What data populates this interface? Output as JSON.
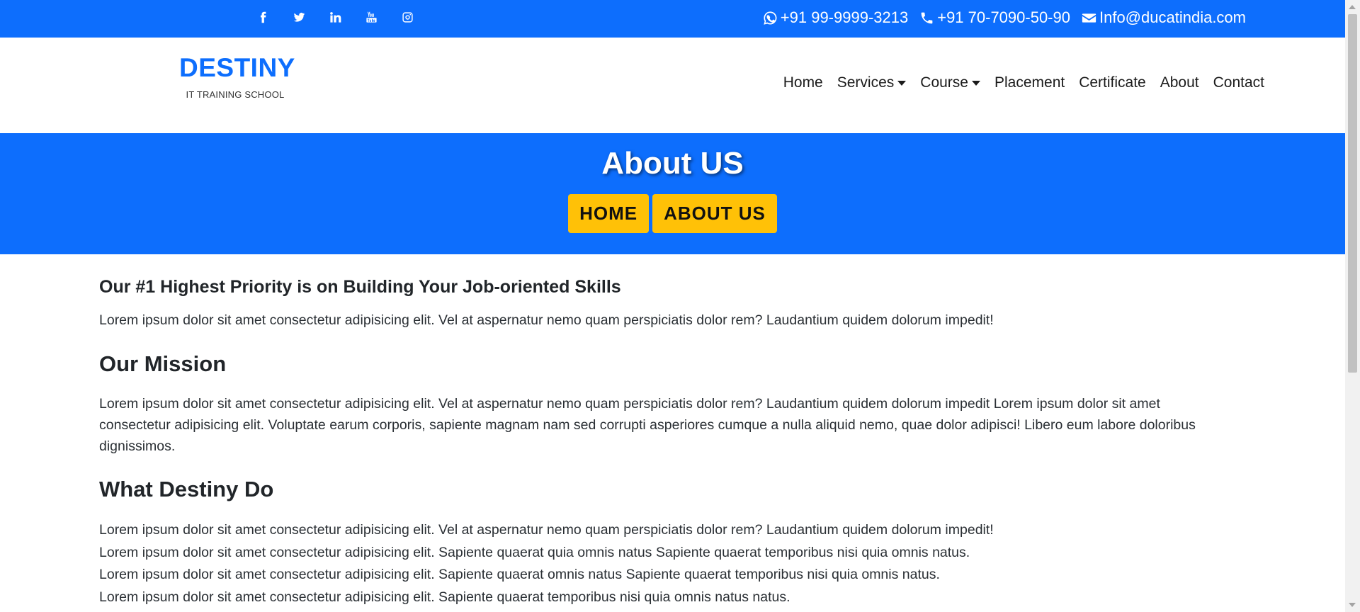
{
  "colors": {
    "primary": "#0d6efd",
    "accent": "#ffc107"
  },
  "topbar": {
    "social": [
      {
        "name": "facebook-icon"
      },
      {
        "name": "twitter-icon"
      },
      {
        "name": "linkedin-icon"
      },
      {
        "name": "youtube-icon"
      },
      {
        "name": "instagram-icon"
      }
    ],
    "contact": {
      "whatsapp": "+91 99-9999-3213",
      "phone": "+91 70-7090-50-90",
      "email": "Info@ducatindia.com"
    }
  },
  "brand": {
    "name": "DESTINY",
    "tagline": "IT TRAINING SCHOOL"
  },
  "nav": {
    "home": "Home",
    "services": "Services",
    "course": "Course",
    "placement": "Placement",
    "certificate": "Certificate",
    "about": "About",
    "contact": "Contact"
  },
  "hero": {
    "title": "About US",
    "breadcrumb_home": "HOME",
    "breadcrumb_current": "ABOUT US"
  },
  "content": {
    "priority_heading": "Our #1 Highest Priority is on Building Your Job-oriented Skills",
    "priority_text": "Lorem ipsum dolor sit amet consectetur adipisicing elit. Vel at aspernatur nemo quam perspiciatis dolor rem? Laudantium quidem dolorum impedit!",
    "mission_heading": "Our Mission",
    "mission_text": "Lorem ipsum dolor sit amet consectetur adipisicing elit. Vel at aspernatur nemo quam perspiciatis dolor rem? Laudantium quidem dolorum impedit Lorem ipsum dolor sit amet consectetur adipisicing elit. Voluptate earum corporis, sapiente magnam nam sed corrupti asperiores cumque a nulla aliquid nemo, quae dolor adipisci! Libero eum labore doloribus dignissimos.",
    "do_heading": "What Destiny Do",
    "do_lines": [
      "Lorem ipsum dolor sit amet consectetur adipisicing elit. Vel at aspernatur nemo quam perspiciatis dolor rem? Laudantium quidem dolorum impedit!",
      "Lorem ipsum dolor sit amet consectetur adipisicing elit. Sapiente quaerat quia omnis natus Sapiente quaerat temporibus nisi quia omnis natus.",
      "Lorem ipsum dolor sit amet consectetur adipisicing elit. Sapiente quaerat omnis natus Sapiente quaerat temporibus nisi quia omnis natus.",
      "Lorem ipsum dolor sit amet consectetur adipisicing elit. Sapiente quaerat temporibus nisi quia omnis natus natus."
    ]
  }
}
